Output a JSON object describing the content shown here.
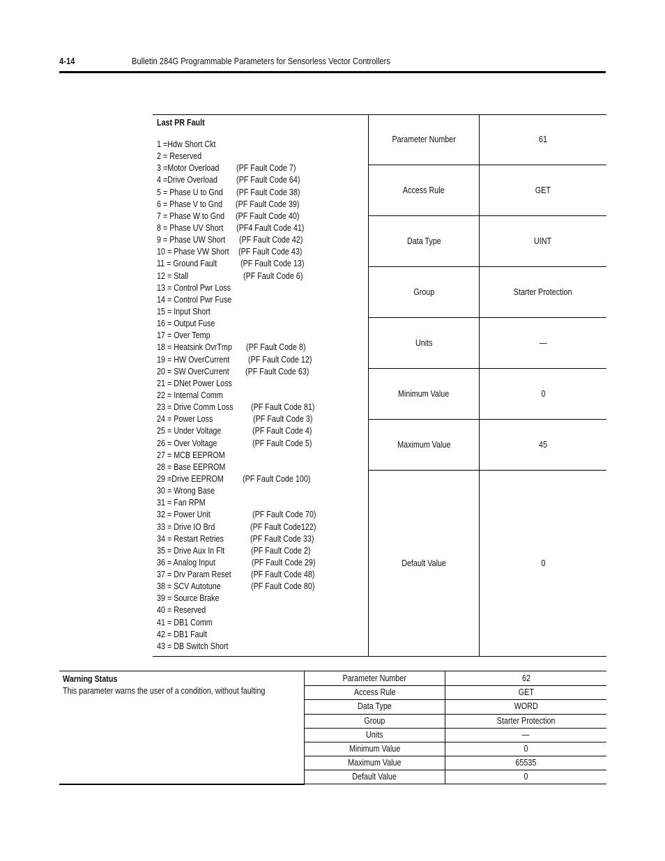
{
  "header": {
    "page_number": "4-14",
    "title": "Bulletin 284G Programmable Parameters for Sensorless Vector Controllers"
  },
  "last_pr_fault": {
    "title": "Last PR Fault",
    "faults": [
      {
        "label": "1 =Hdw Short Ckt",
        "code": ""
      },
      {
        "label": "2 = Reserved",
        "code": ""
      },
      {
        "label": "3 =Motor Overload",
        "code": "(PF Fault Code 7)"
      },
      {
        "label": "4 =Drive Overload",
        "code": "(PF Fault Code 64)"
      },
      {
        "label": "5 = Phase U to Gnd",
        "code": "(PF Fault Code 38)"
      },
      {
        "label": "6 = Phase V to Gnd",
        "code": "(PF Fault Code 39)"
      },
      {
        "label": "7 = Phase W to Gnd",
        "code": "(PF Fault Code 40)"
      },
      {
        "label": "8 = Phase UV Short",
        "code": "(PF4 Fault Code 41)"
      },
      {
        "label": "9 = Phase UW Short",
        "code": "(PF Fault Code 42)"
      },
      {
        "label": "10 = Phase VW Short",
        "code": "(PF Fault Code 43)"
      },
      {
        "label": "11 = Ground Fault",
        "code": "(PF Fault Code 13)"
      },
      {
        "label": "12 = Stall",
        "code": "(PF Fault Code 6)"
      },
      {
        "label": "13 = Control Pwr Loss",
        "code": ""
      },
      {
        "label": "14 = Control Pwr Fuse",
        "code": ""
      },
      {
        "label": "15 = Input Short",
        "code": ""
      },
      {
        "label": "16 = Output Fuse",
        "code": ""
      },
      {
        "label": "17 = Over Temp",
        "code": ""
      },
      {
        "label": "18 = Heatsink OvrTmp",
        "code": "(PF Fault Code 8)"
      },
      {
        "label": "19 = HW OverCurrent",
        "code": "(PF Fault Code 12)"
      },
      {
        "label": "20 = SW OverCurrent",
        "code": "(PF Fault Code 63)"
      },
      {
        "label": "21 = DNet Power Loss",
        "code": ""
      },
      {
        "label": "22 = Internal Comm",
        "code": ""
      },
      {
        "label": "23 = Drive Comm Loss",
        "code": "(PF Fault Code 81)"
      },
      {
        "label": "24 = Power Loss",
        "code": "(PF Fault Code 3)"
      },
      {
        "label": "25 = Under Voltage",
        "code": "(PF Fault Code 4)"
      },
      {
        "label": "26 = Over Voltage",
        "code": "(PF Fault Code 5)"
      },
      {
        "label": "27 = MCB EEPROM",
        "code": ""
      },
      {
        "label": "28 = Base EEPROM",
        "code": ""
      },
      {
        "label": "29 =Drive EEPROM",
        "code": "(PF Fault Code 100)"
      },
      {
        "label": "30 = Wrong Base",
        "code": ""
      },
      {
        "label": "31 = Fan RPM",
        "code": ""
      },
      {
        "label": "32 = Power Unit",
        "code": "(PF Fault Code 70)"
      },
      {
        "label": "33 = Drive IO Brd",
        "code": "(PF Fault Code122)"
      },
      {
        "label": "34 = Restart Retries",
        "code": "(PF Fault Code 33)"
      },
      {
        "label": "35 = Drive Aux In Flt",
        "code": "(PF Fault Code 2)"
      },
      {
        "label": "36 = Analog Input",
        "code": "(PF Fault Code 29)"
      },
      {
        "label": "37 = Drv Param Reset",
        "code": "(PF Fault Code 48)"
      },
      {
        "label": "38 = SCV Autotune",
        "code": "(PF Fault Code 80)"
      },
      {
        "label": "39 = Source Brake",
        "code": ""
      },
      {
        "label": "40 = Reserved",
        "code": ""
      },
      {
        "label": "41 = DB1 Comm",
        "code": ""
      },
      {
        "label": "42 = DB1 Fault",
        "code": ""
      },
      {
        "label": "43 = DB Switch Short",
        "code": ""
      }
    ],
    "properties": [
      {
        "key": "Parameter Number",
        "value": "61"
      },
      {
        "key": "Access Rule",
        "value": "GET"
      },
      {
        "key": "Data Type",
        "value": "UINT"
      },
      {
        "key": "Group",
        "value": "Starter Protection"
      },
      {
        "key": "Units",
        "value": "—"
      },
      {
        "key": "Minimum Value",
        "value": "0"
      },
      {
        "key": "Maximum Value",
        "value": "45"
      },
      {
        "key": "Default Value",
        "value": "0"
      }
    ]
  },
  "warning_status": {
    "title": "Warning Status",
    "description": "This parameter warns the user of a condition, without faulting",
    "properties": [
      {
        "key": "Parameter Number",
        "value": "62"
      },
      {
        "key": "Access Rule",
        "value": "GET"
      },
      {
        "key": "Data Type",
        "value": "WORD"
      },
      {
        "key": "Group",
        "value": "Starter Protection"
      },
      {
        "key": "Units",
        "value": "—"
      },
      {
        "key": "Minimum Value",
        "value": "0"
      },
      {
        "key": "Maximum Value",
        "value": "65535"
      },
      {
        "key": "Default Value",
        "value": "0"
      }
    ]
  }
}
